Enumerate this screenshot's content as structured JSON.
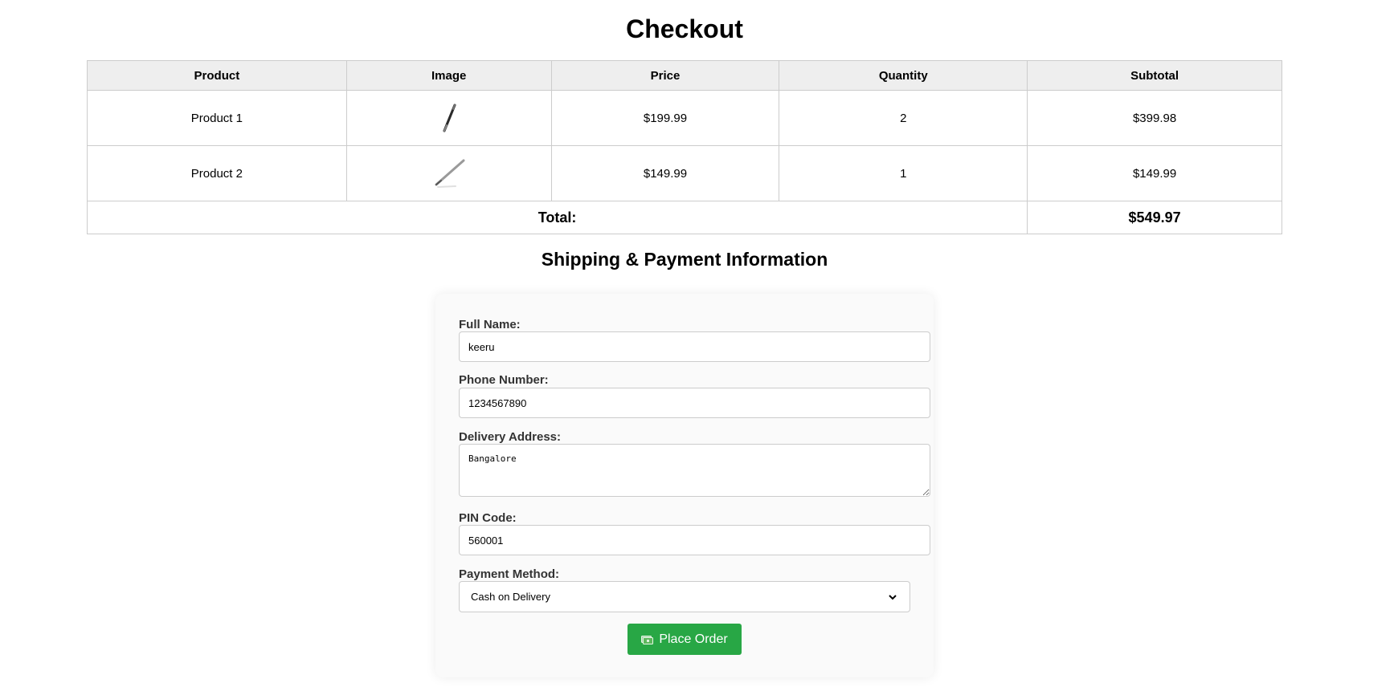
{
  "page": {
    "title": "Checkout"
  },
  "cart": {
    "headers": [
      "Product",
      "Image",
      "Price",
      "Quantity",
      "Subtotal"
    ],
    "rows": [
      {
        "product": "Product 1",
        "image_icon": "pen-image",
        "price": "$199.99",
        "quantity": "2",
        "subtotal": "$399.98"
      },
      {
        "product": "Product 2",
        "image_icon": "pen-image",
        "price": "$149.99",
        "quantity": "1",
        "subtotal": "$149.99"
      }
    ],
    "total_label": "Total:",
    "total_value": "$549.97"
  },
  "shipping": {
    "title": "Shipping & Payment Information",
    "full_name_label": "Full Name:",
    "full_name_value": "keeru",
    "phone_label": "Phone Number:",
    "phone_value": "1234567890",
    "address_label": "Delivery Address:",
    "address_value": "Bangalore",
    "pin_label": "PIN Code:",
    "pin_value": "560001",
    "payment_label": "Payment Method:",
    "payment_value": "Cash on Delivery",
    "place_order_label": "Place Order"
  },
  "colors": {
    "button_bg": "#28a745",
    "header_bg": "#eeeeee",
    "border": "#cccccc"
  }
}
